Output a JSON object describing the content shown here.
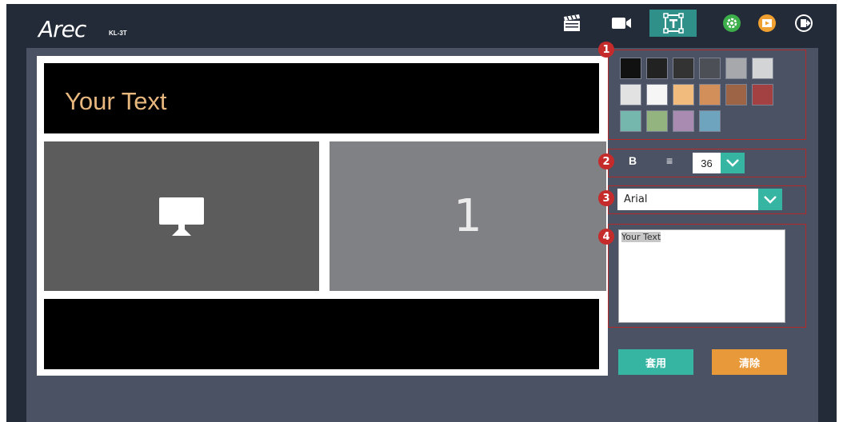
{
  "header": {
    "logo": "Arec",
    "model": "KL-3T"
  },
  "nav_icons": [
    "clapperboard-icon",
    "camera-icon",
    "text-overlay-icon",
    "settings-icon",
    "media-icon",
    "logout-icon"
  ],
  "colors": {
    "accent_teal": "#35b5a2",
    "accent_orange": "#e89a3a",
    "badge_red": "#c62b2b",
    "preview_text": "#e7b77e"
  },
  "preview": {
    "top_text": "Your Text",
    "right_zone_number": "1"
  },
  "color_palette": [
    "#111111",
    "#222222",
    "#333333",
    "#4c4f55",
    "#a6a8ab",
    "#d3d4d5",
    "#e2e2e2",
    "#f6f6f6",
    "#f2bb7e",
    "#d38f5a",
    "#9d6546",
    "#a34142",
    "#76b7ad",
    "#93b47e",
    "#a98bb2",
    "#6ea4bd"
  ],
  "badges": [
    "1",
    "2",
    "3",
    "4"
  ],
  "format": {
    "bold_label": "B",
    "align_label": "≡",
    "font_size": "36"
  },
  "font": {
    "selected": "Arial"
  },
  "text_input": {
    "value": "Your Text"
  },
  "buttons": {
    "apply": "套用",
    "clear": "清除"
  }
}
